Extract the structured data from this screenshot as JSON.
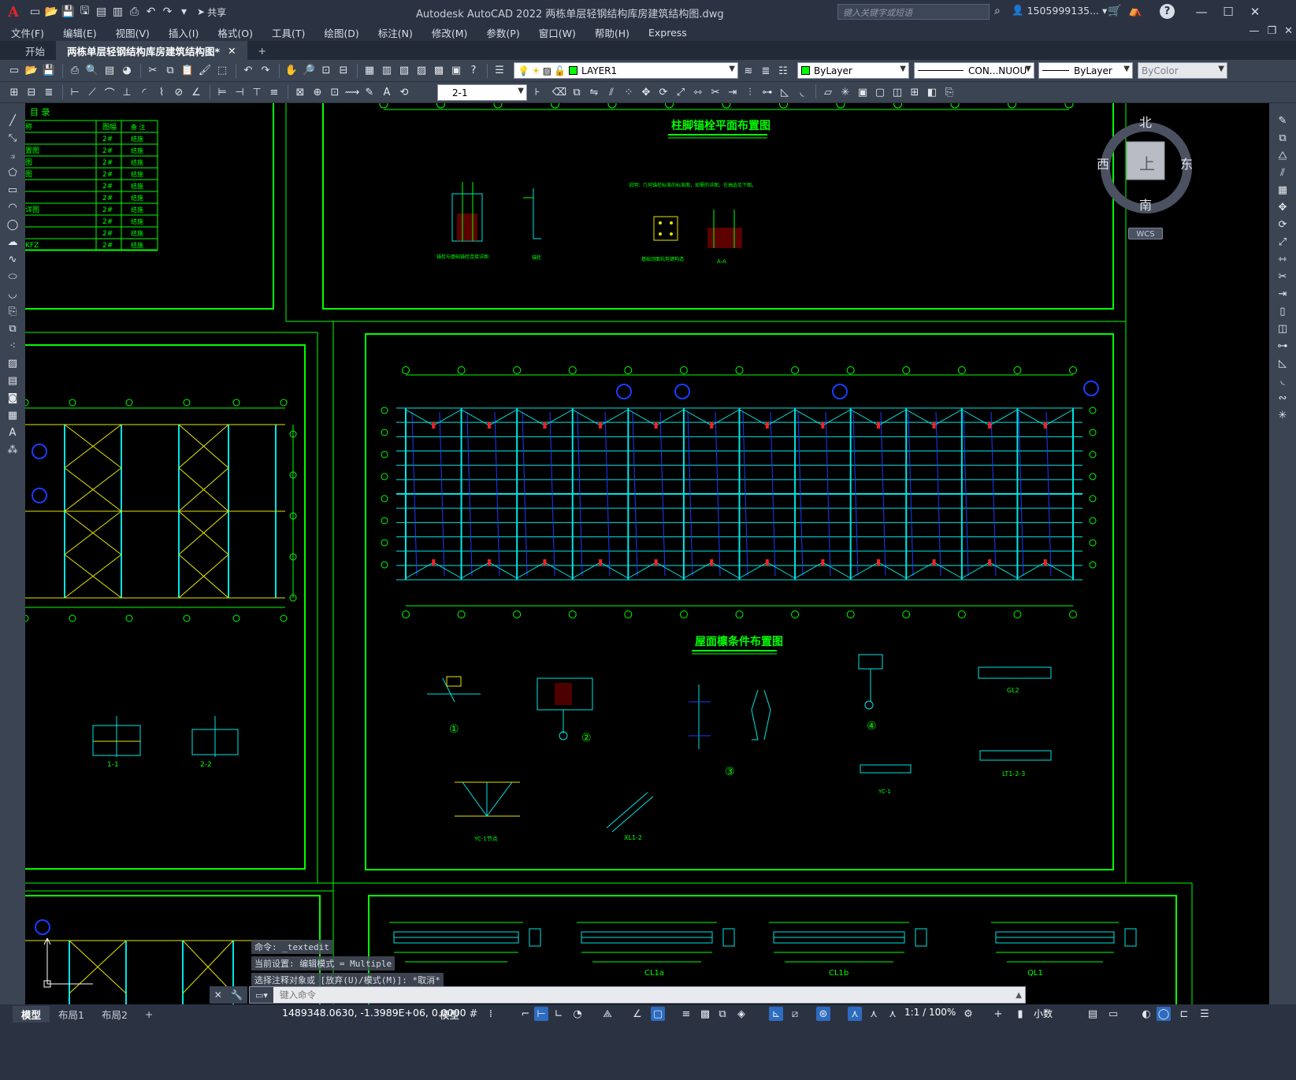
{
  "titlebar": {
    "app_logo": "A",
    "share": "共享",
    "title": "Autodesk AutoCAD 2022    两栋单层轻钢结构库房建筑结构图.dwg",
    "search_placeholder": "键入关键字或短语",
    "user": "1505999135...",
    "help": "?"
  },
  "menu": [
    "文件(F)",
    "编辑(E)",
    "视图(V)",
    "插入(I)",
    "格式(O)",
    "工具(T)",
    "绘图(D)",
    "标注(N)",
    "修改(M)",
    "参数(P)",
    "窗口(W)",
    "帮助(H)",
    "Express"
  ],
  "tabs": {
    "start": "开始",
    "drawing": "两栋单层轻钢结构库房建筑结构图*",
    "close": "✕",
    "add": "+"
  },
  "toolbar": {
    "layer": "LAYER1",
    "color": "ByLayer",
    "linetype": "CON...NUOU",
    "lineweight": "ByLayer",
    "plotstyle": "ByColor",
    "dimstyle": "2-1"
  },
  "viewcube": {
    "north": "北",
    "south": "南",
    "east": "东",
    "west": "西",
    "face": "上",
    "wcs": "WCS"
  },
  "drawing": {
    "title_anchor": "柱脚锚栓平面布置图",
    "title_purlin": "屋面檩条件布置图",
    "catalog_head": [
      "目  录"
    ],
    "catalog_cols": [
      "图幅",
      "备 注"
    ],
    "catalog_rows": [
      {
        "name": "称",
        "size": "图幅",
        "note": "备 注"
      },
      {
        "name": "",
        "size": "2#",
        "note": "结施"
      },
      {
        "name": "置图",
        "size": "2#",
        "note": "结施"
      },
      {
        "name": "图",
        "size": "2#",
        "note": "结施"
      },
      {
        "name": "图",
        "size": "2#",
        "note": "结施"
      },
      {
        "name": "",
        "size": "2#",
        "note": "结施"
      },
      {
        "name": "",
        "size": "2#",
        "note": "结施"
      },
      {
        "name": "详图",
        "size": "2#",
        "note": "结施"
      },
      {
        "name": "",
        "size": "2#",
        "note": "结施"
      },
      {
        "name": "",
        "size": "2#",
        "note": "结施"
      },
      {
        "name": "KFZ",
        "size": "2#",
        "note": "结施"
      }
    ],
    "labels": {
      "detail_1": "1-1",
      "detail_2": "2-2",
      "aa": "A-A",
      "gl2": "GL2",
      "lt1": "LT1-2-3",
      "yc1": "YC-1",
      "xl12": "XL1-2",
      "yc_node": "YC-1节点",
      "cl1a": "CL1a",
      "cl1b": "CL1b",
      "ql1": "QL1",
      "m1": "①",
      "m2": "②",
      "m3": "③",
      "m4": "④",
      "anchor1": "锚栓与基础锚栓连接详图",
      "anchor2": "锚栓",
      "anchor3": "基础顶面抗剪键构造",
      "note": "说明：几何锚栓标准的标准图，如需的详图，在抽选见下图。"
    }
  },
  "command": {
    "history": [
      "命令:  _textedit",
      "当前设置: 编辑模式 = Multiple",
      "选择注释对象或 [放弃(U)/模式(M)]: *取消*"
    ],
    "placeholder": "键入命令"
  },
  "status": {
    "layout_tabs": [
      "模型",
      "布局1",
      "布局2"
    ],
    "add_tab": "+",
    "coords": "1489348.0630, -1.3989E+06, 0.0000",
    "model": "模型",
    "scale": "1:1 / 100%",
    "units": "小数"
  },
  "colors": {
    "bg": "#000000",
    "chrome": "#3b4453",
    "titlebar": "#2b3342",
    "cad_green": "#00ff00",
    "cad_cyan": "#00e5e5",
    "cad_blue": "#1a3cff",
    "cad_yellow": "#e6e600",
    "cad_red": "#ff2020"
  }
}
